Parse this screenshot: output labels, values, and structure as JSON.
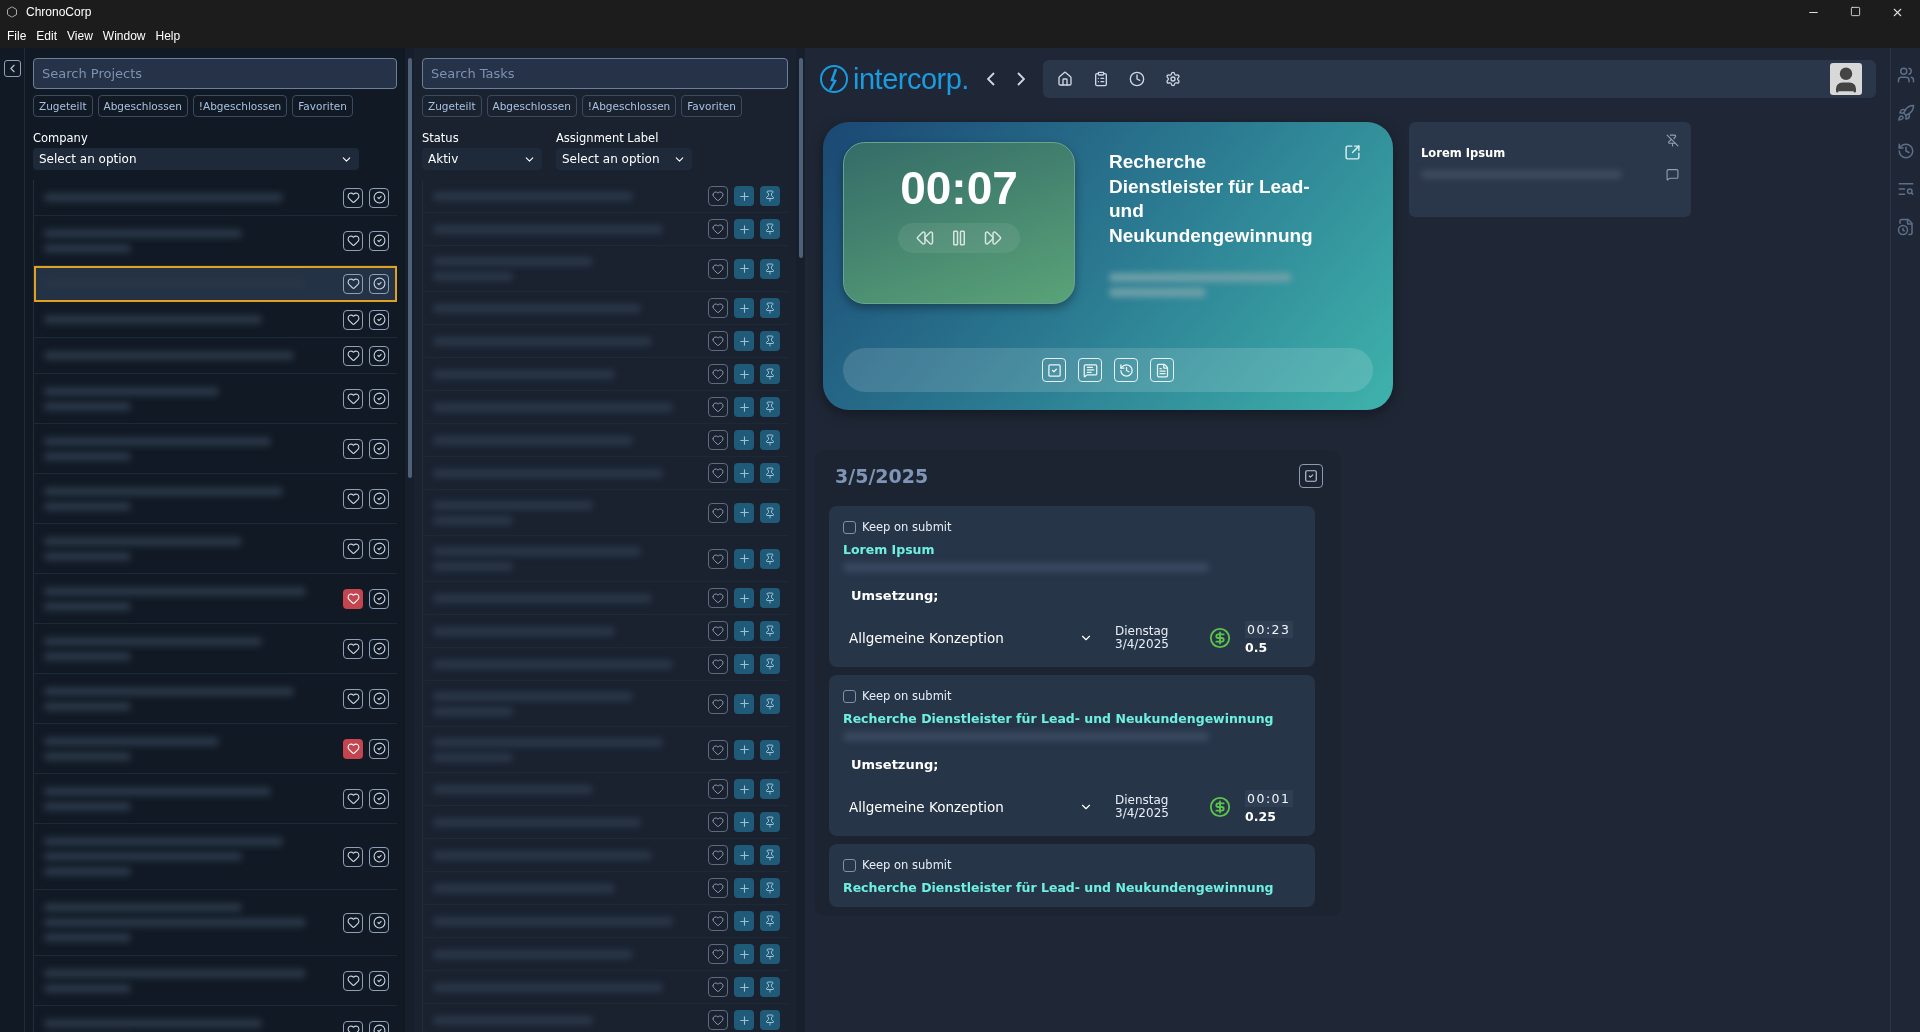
{
  "window": {
    "title": "ChronoCorp"
  },
  "menu": [
    "File",
    "Edit",
    "View",
    "Window",
    "Help"
  ],
  "projects": {
    "search": {
      "placeholder": "Search Projects"
    },
    "filters": [
      "Zugeteilt",
      "Abgeschlossen",
      "!Abgeschlossen",
      "Favoriten"
    ],
    "company": {
      "label": "Company",
      "value": "Select an option"
    },
    "rows": [
      {
        "kind": "single",
        "favorite": false,
        "selected": false
      },
      {
        "kind": "double",
        "favorite": false,
        "selected": false
      },
      {
        "kind": "single",
        "favorite": false,
        "selected": true
      },
      {
        "kind": "single",
        "favorite": false,
        "selected": false
      },
      {
        "kind": "single",
        "favorite": false,
        "selected": false
      },
      {
        "kind": "double",
        "favorite": false,
        "selected": false
      },
      {
        "kind": "double",
        "favorite": false,
        "selected": false
      },
      {
        "kind": "double",
        "favorite": false,
        "selected": false
      },
      {
        "kind": "double",
        "favorite": false,
        "selected": false
      },
      {
        "kind": "double",
        "favorite": true,
        "selected": false
      },
      {
        "kind": "double",
        "favorite": false,
        "selected": false
      },
      {
        "kind": "double",
        "favorite": false,
        "selected": false
      },
      {
        "kind": "double",
        "favorite": true,
        "selected": false
      },
      {
        "kind": "double",
        "favorite": false,
        "selected": false
      },
      {
        "kind": "triple",
        "favorite": false,
        "selected": false
      },
      {
        "kind": "triple",
        "favorite": false,
        "selected": false
      },
      {
        "kind": "double",
        "favorite": false,
        "selected": false
      },
      {
        "kind": "double",
        "favorite": false,
        "selected": false
      }
    ]
  },
  "tasks": {
    "search": {
      "placeholder": "Search Tasks"
    },
    "filters": [
      "Zugeteilt",
      "Abgeschlossen",
      "!Abgeschlossen",
      "Favoriten"
    ],
    "status": {
      "label": "Status",
      "value": "Aktiv"
    },
    "assignment": {
      "label": "Assignment Label",
      "value": "Select an option"
    },
    "rows": [
      {
        "kind": "single",
        "favorite": false
      },
      {
        "kind": "single",
        "favorite": false
      },
      {
        "kind": "double",
        "favorite": false
      },
      {
        "kind": "single",
        "favorite": false
      },
      {
        "kind": "single",
        "favorite": false
      },
      {
        "kind": "single",
        "favorite": false
      },
      {
        "kind": "single",
        "favorite": false
      },
      {
        "kind": "single",
        "favorite": false
      },
      {
        "kind": "single",
        "favorite": false
      },
      {
        "kind": "double",
        "favorite": false
      },
      {
        "kind": "double",
        "favorite": false
      },
      {
        "kind": "single",
        "favorite": false
      },
      {
        "kind": "single",
        "favorite": false
      },
      {
        "kind": "single",
        "favorite": false
      },
      {
        "kind": "double",
        "favorite": false
      },
      {
        "kind": "double",
        "favorite": false
      },
      {
        "kind": "single",
        "favorite": false
      },
      {
        "kind": "single",
        "favorite": false
      },
      {
        "kind": "single",
        "favorite": false
      },
      {
        "kind": "single",
        "favorite": false
      },
      {
        "kind": "single",
        "favorite": false
      },
      {
        "kind": "single",
        "favorite": false
      },
      {
        "kind": "single",
        "favorite": false
      },
      {
        "kind": "single",
        "favorite": false
      }
    ]
  },
  "header": {
    "logo": "intercorp."
  },
  "timer": {
    "time": "00:07",
    "title": "Recherche Dienstleister für Lead- und Neukundengewinnung"
  },
  "pinned": {
    "title": "Lorem Ipsum"
  },
  "day": {
    "date": "3/5/2025",
    "entries": [
      {
        "keep": false,
        "keep_label": "Keep on submit",
        "title": "Lorem Ipsum",
        "note": "Umsetzung;",
        "activity": "Allgemeine Konzeption",
        "weekday": "Dienstag",
        "date": "3/4/2025",
        "billable": true,
        "time": "00:23",
        "hours": "0.5"
      },
      {
        "keep": false,
        "keep_label": "Keep on submit",
        "title": "Recherche Dienstleister für Lead- und Neukundengewinnung",
        "note": "Umsetzung;",
        "activity": "Allgemeine Konzeption",
        "weekday": "Dienstag",
        "date": "3/4/2025",
        "billable": true,
        "time": "00:01",
        "hours": "0.25"
      },
      {
        "keep": false,
        "keep_label": "Keep on submit",
        "title": "Recherche Dienstleister für Lead- und Neukundengewinnung"
      }
    ]
  }
}
